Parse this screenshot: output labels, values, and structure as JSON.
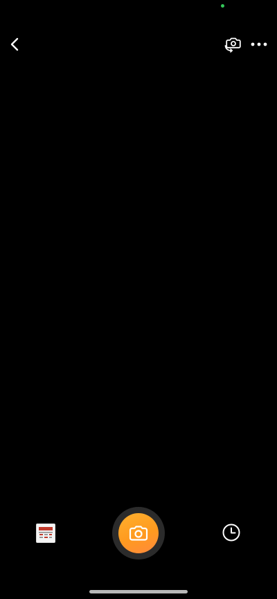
{
  "status_bar": {
    "indicator_color": "#34c759"
  },
  "top_bar": {
    "back_icon": "chevron-left-icon",
    "switch_camera_icon": "camera-switch-icon",
    "more_icon": "more-horizontal-icon"
  },
  "bottom_bar": {
    "gallery_icon": "gallery-thumbnail",
    "shutter_icon": "camera-icon",
    "history_icon": "clock-icon",
    "shutter_color": "#ff9f1c"
  },
  "colors": {
    "background": "#000000",
    "icon": "#ffffff",
    "accent": "#ff9f1c"
  }
}
